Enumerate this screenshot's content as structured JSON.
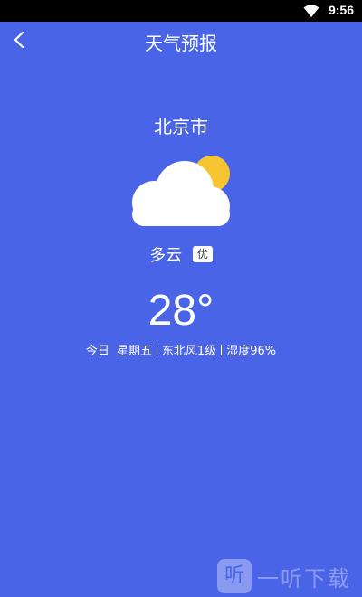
{
  "status_bar": {
    "time": "9:56",
    "wifi_icon": "wifi-icon"
  },
  "header": {
    "back_icon": "chevron-left-icon",
    "title": "天气预报"
  },
  "weather": {
    "city": "北京市",
    "icon": "partly-cloudy-icon",
    "condition": "多云",
    "air_quality": "优",
    "temperature": "28°",
    "day": "今日",
    "weekday": "星期五",
    "wind": "东北风1级",
    "humidity": "湿度96%"
  },
  "watermark": {
    "logo_text": "听",
    "text": "一听下载"
  },
  "colors": {
    "background": "#4a64e8",
    "sun": "#f7c531",
    "cloud": "#ffffff",
    "status_bar": "#000000"
  }
}
